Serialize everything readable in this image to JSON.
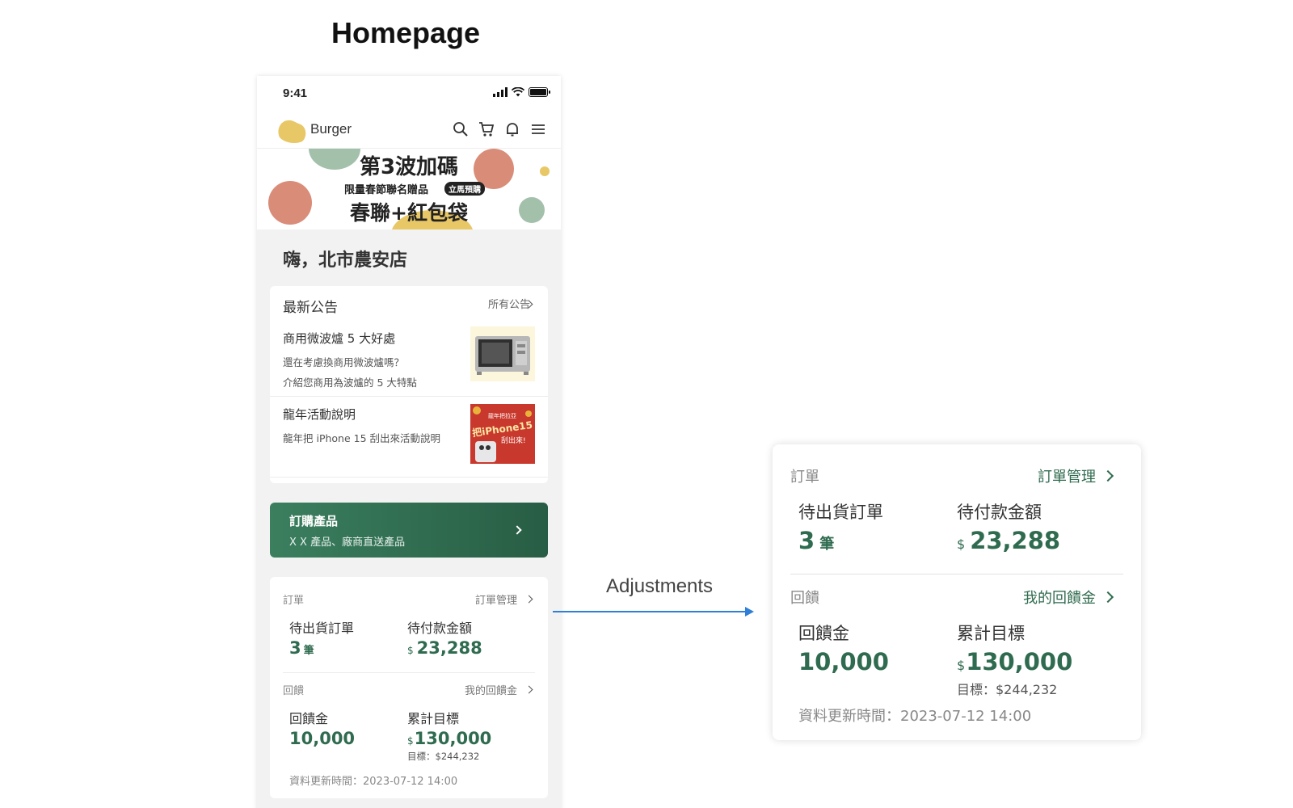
{
  "heading": "Homepage",
  "phone": {
    "status_time": "9:41",
    "brand": "Burger",
    "banner": {
      "line1": "第3波加碼",
      "line2": "限量春節聯名贈品",
      "badge": "立馬預購",
      "line3": "春聯+紅包袋"
    },
    "greeting": "嗨，北市農安店",
    "announcements": {
      "title": "最新公告",
      "all_link": "所有公告",
      "items": [
        {
          "title": "商用微波爐 5 大好處",
          "desc1": "還在考慮換商用微波爐嗎？",
          "desc2": "介紹您商用為波爐的 5 大特點"
        },
        {
          "title": "龍年活動說明",
          "desc1": "龍年把 iPhone 15 刮出來活動說明",
          "thumb_text1": "龍年把拉亞",
          "thumb_text2": "把iPhone15",
          "thumb_text3": "刮出來!"
        }
      ]
    },
    "order_button": {
      "title": "訂購產品",
      "subtitle": "X X 產品、廠商直送產品"
    }
  },
  "summary": {
    "orders_label": "訂單",
    "orders_link": "訂單管理",
    "pending_shipment_label": "待出貨訂單",
    "pending_shipment_value": "3",
    "pending_shipment_unit": "筆",
    "pending_payment_label": "待付款金額",
    "currency": "$",
    "pending_payment_value": "23,288",
    "rebate_label": "回饋",
    "rebate_link": "我的回饋金",
    "rebate_amount_label": "回饋金",
    "rebate_amount_value": "10,000",
    "cumulative_label": "累計目標",
    "cumulative_value": "130,000",
    "target_text": "目標：$244,232",
    "updated_text": "資料更新時間：2023-07-12 14:00"
  },
  "adjustments_label": "Adjustments",
  "colors": {
    "brand_green": "#2f6b4f",
    "arrow_blue": "#2f7fd6",
    "logo_yellow": "#e8c766"
  }
}
